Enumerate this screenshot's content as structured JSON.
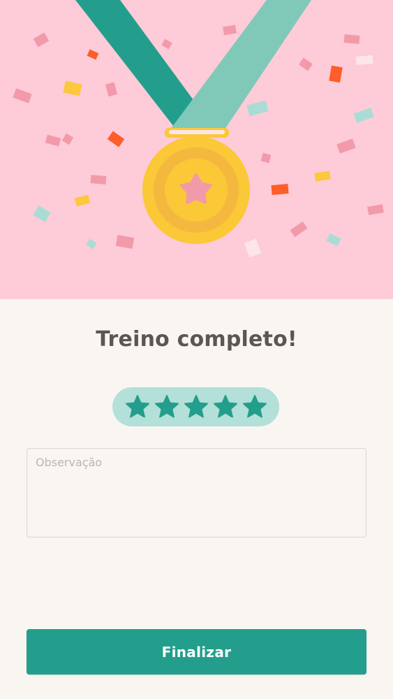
{
  "screen": {
    "title": "Treino completo!",
    "rating": {
      "stars": 5,
      "max": 5
    },
    "note_field": {
      "placeholder": "Observação",
      "value": ""
    },
    "finish_button_label": "Finalizar"
  },
  "illustration": {
    "subject": "gold medal with star on teal ribbon, confetti",
    "icon": "medal-icon"
  },
  "colors": {
    "hero_background": "#fecbd8",
    "page_background": "#f9f6f1",
    "accent": "#239e8c",
    "rating_pill": "#b3e0d8",
    "title_text": "#5b5656",
    "medal_gold": "#fbc837"
  }
}
